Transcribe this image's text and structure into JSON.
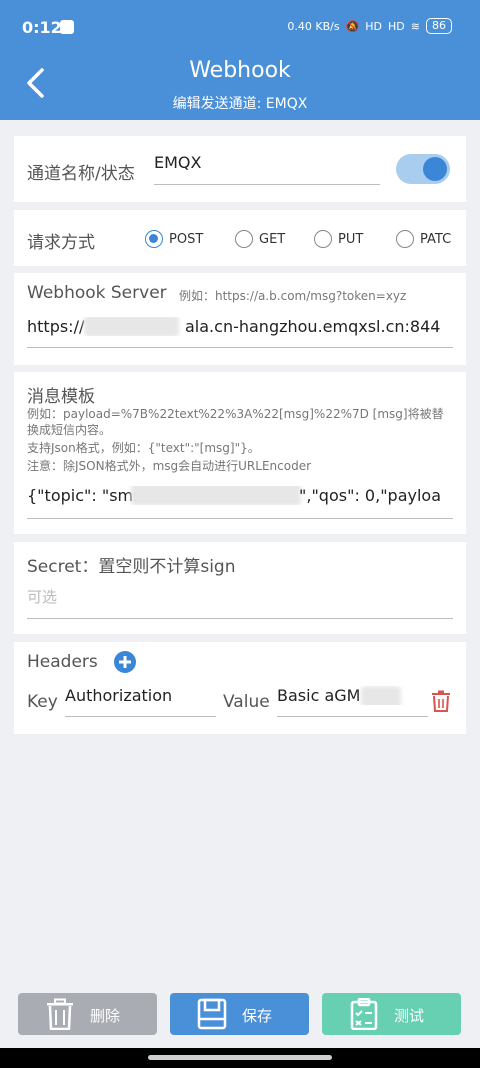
{
  "status_bar": {
    "time": "0:12",
    "net_speed": "0.40 KB/s",
    "signal1": "HD",
    "signal2": "HD",
    "battery": "86"
  },
  "header": {
    "title": "Webhook",
    "subtitle": "编辑发送通道: EMQX",
    "back_icon": "chevron-left-icon"
  },
  "channel": {
    "label": "通道名称/状态",
    "name_value": "EMQX",
    "enabled": true
  },
  "method": {
    "label": "请求方式",
    "options": [
      "POST",
      "GET",
      "PUT",
      "PATC"
    ],
    "selected": "POST"
  },
  "server": {
    "label": "Webhook Server",
    "hint": "例如：https://a.b.com/msg?token=xyz",
    "value_prefix": "https://",
    "value_suffix": "ala.cn-hangzhou.emqxsl.cn:844"
  },
  "template": {
    "label": "消息模板",
    "desc1": "例如：payload=%7B%22text%22%3A%22[msg]%22%7D [msg]将被替",
    "desc2": "换成短信内容。",
    "desc3": "支持Json格式，例如：{\"text\":\"[msg]\"}。",
    "desc4": "注意：除JSON格式外，msg会自动进行URLEncoder",
    "value_prefix": "{\"topic\": \"sms",
    "value_suffix": "\",\"qos\": 0,\"payloa"
  },
  "secret": {
    "label": "Secret：置空则不计算sign",
    "placeholder": "可选"
  },
  "headers": {
    "label": "Headers",
    "key_label": "Key",
    "key_value": "Authorization",
    "value_label": "Value",
    "value_value": "Basic aGM"
  },
  "actions": {
    "delete": "删除",
    "save": "保存",
    "test": "测试",
    "delete_color": "#a9adb3",
    "save_color": "#4a90d9",
    "test_color": "#67d0b2"
  }
}
